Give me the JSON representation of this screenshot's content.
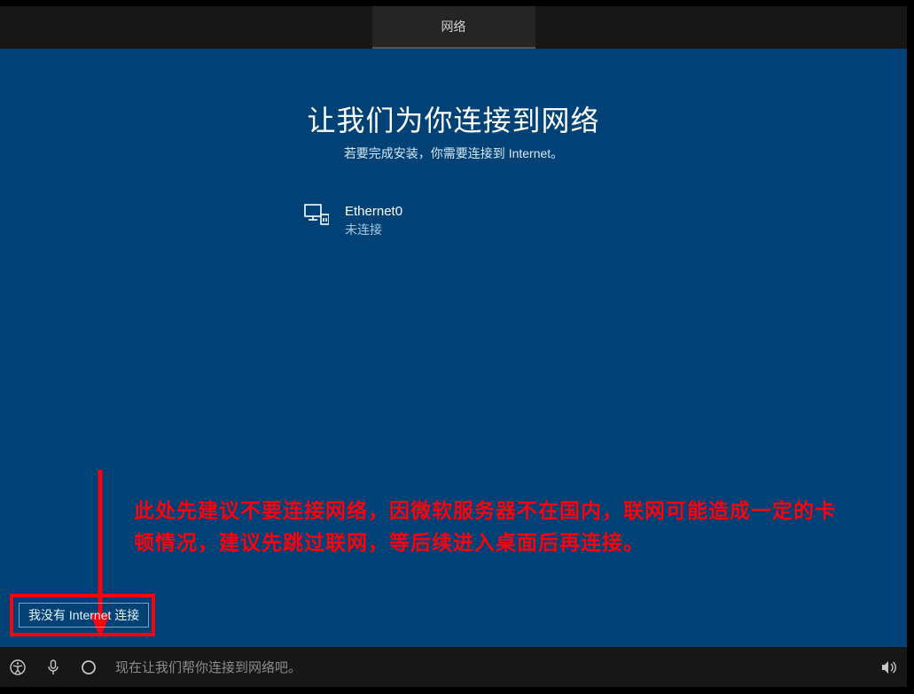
{
  "topbar": {
    "tab_label": "网络"
  },
  "heading": "让我们为你连接到网络",
  "subheading": "若要完成安装，你需要连接到 Internet。",
  "network": {
    "name": "Ethernet0",
    "status": "未连接"
  },
  "skip_button_label": "我没有 Internet 连接",
  "annotation_text": "此处先建议不要连接网络，因微软服务器不在国内，联网可能造成一定的卡顿情况，建议先跳过联网，等后续进入桌面后再连接。",
  "bottombar_text": "现在让我们帮你连接到网络吧。",
  "icons": {
    "ethernet": "ethernet-icon",
    "ease_of_access": "ease-of-access-icon",
    "microphone": "microphone-icon",
    "cortana": "cortana-icon",
    "volume": "volume-icon"
  }
}
